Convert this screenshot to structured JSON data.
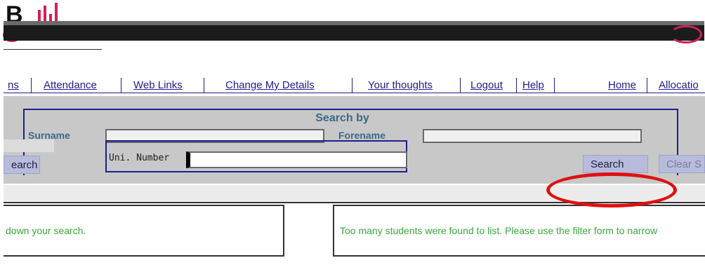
{
  "nav": {
    "items": [
      {
        "label": "ns"
      },
      {
        "label": "Attendance"
      },
      {
        "label": "Web Links"
      },
      {
        "label": "Change My Details"
      },
      {
        "label": "Your thoughts"
      },
      {
        "label": "Logout"
      },
      {
        "label": "Help"
      },
      {
        "label": "Home"
      },
      {
        "label": "Allocatio"
      }
    ]
  },
  "search": {
    "title": "Search by",
    "surname_label": "Surname",
    "forename_label": "Forename",
    "uni_label": "Uni. Number",
    "surname_value": "",
    "forename_value": "",
    "uni_value": "",
    "search_left_label": "earch",
    "search_label": "Search",
    "clear_label": "Clear S"
  },
  "messages": {
    "left": "down your search.",
    "right": "Too many students were found to list. Please use the filter form to narrow"
  },
  "colors": {
    "nav_text": "#1e1e8a",
    "message_text": "#3aa83a",
    "annotation": "#e01010"
  }
}
